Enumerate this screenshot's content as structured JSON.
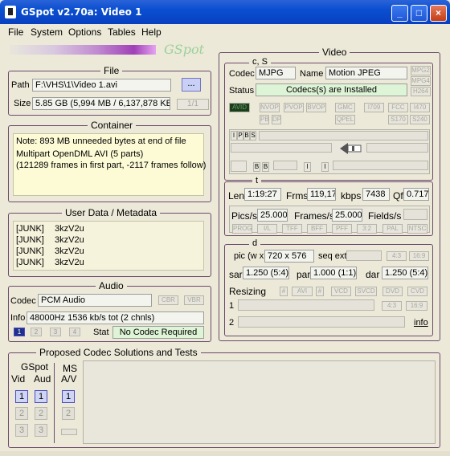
{
  "window": {
    "title": "GSpot v2.70a: Video 1",
    "min": "_",
    "max": "□",
    "close": "×"
  },
  "menu": [
    "File",
    "System",
    "Options",
    "Tables",
    "Help"
  ],
  "logo": "GSpot",
  "file": {
    "title": "File",
    "path_label": "Path",
    "path": "F:\\VHS\\1\\Video 1.avi",
    "browse": "...",
    "size_label": "Size",
    "size": "5.85 GB (5,994 MB / 6,137,878 KB",
    "part": "1/1"
  },
  "container": {
    "title": "Container",
    "note": "Note: 893 MB unneeded bytes at end of file",
    "lines": [
      "Multipart OpenDML AVI (5 parts)",
      "(121289 frames in first part, -2117 frames follow)"
    ]
  },
  "userdata": {
    "title": "User Data / Metadata",
    "rows": [
      [
        "[JUNK]",
        "3kzV2u"
      ],
      [
        "[JUNK]",
        "3kzV2u"
      ],
      [
        "[JUNK]",
        "3kzV2u"
      ],
      [
        "[JUNK]",
        "3kzV2u"
      ]
    ]
  },
  "audio": {
    "title": "Audio",
    "codec_label": "Codec",
    "codec": "PCM Audio",
    "cbr": "CBR",
    "vbr": "VBR",
    "info_label": "Info",
    "info": "48000Hz  1536 kb/s tot (2 chnls)",
    "tabs": [
      "1",
      "2",
      "3",
      "4"
    ],
    "stat_label": "Stat",
    "stat": "No Codec Required"
  },
  "video": {
    "title": "Video",
    "cs": "c, S",
    "codec_label": "Codec",
    "codec": "MJPG",
    "name_label": "Name",
    "name": "Motion JPEG",
    "fmt": [
      "MPG2",
      "MPG4",
      "H264"
    ],
    "status_label": "Status",
    "status": "Codecs(s) are Installed",
    "flags_row1": [
      "NVOP",
      "PVOP",
      "BVOP",
      "GMC",
      "I709",
      "FCC",
      "I470"
    ],
    "avid": "AVID",
    "flags_row2": [
      "PB",
      "DP",
      "QPEL",
      "S170",
      "S240"
    ],
    "frame_types": [
      "I",
      "P",
      "B",
      "S"
    ],
    "bp": [
      "B",
      "B"
    ],
    "ix": [
      "I",
      "I"
    ]
  },
  "t": {
    "title": "t",
    "len_label": "Len",
    "len": "1:19:27",
    "frms_label": "Frms",
    "frms": "119,17",
    "kbps_label": "kbps",
    "kbps": "7438",
    "qf_label": "Qf",
    "qf": "0.717",
    "pics_label": "Pics/s",
    "pics": "25.000",
    "frames_label": "Frames/s",
    "frames": "25.000",
    "fields_label": "Fields/s",
    "tags": [
      "PROG",
      "I/L",
      "TFF",
      "BFF",
      "PFF",
      "3:2",
      "PAL",
      "NTSC"
    ]
  },
  "d": {
    "title": "d",
    "pic_label": "pic (w x",
    "pic": "720 x 576",
    "seqext_label": "seq ext",
    "ar": [
      "4:3",
      "16:9"
    ],
    "sar_label": "sar",
    "sar": "1.250 (5:4)",
    "par_label": "par",
    "par": "1.000 (1:1)",
    "dar_label": "dar",
    "dar": "1.250 (5:4)",
    "resizing_label": "Resizing",
    "resize_btns": [
      "#",
      "AVI",
      "#",
      "VCD",
      "SVCD",
      "DVD",
      "CVD"
    ],
    "r1": "1",
    "r2": "2",
    "ar2": [
      "4:3",
      "16:9"
    ],
    "info": "info"
  },
  "proposed": {
    "title": "Proposed Codec Solutions and Tests",
    "gspot": "GSpot",
    "vid": "Vid",
    "aud": "Aud",
    "ms": "MS",
    "av": "A/V",
    "nums": [
      "1",
      "2",
      "3"
    ]
  }
}
